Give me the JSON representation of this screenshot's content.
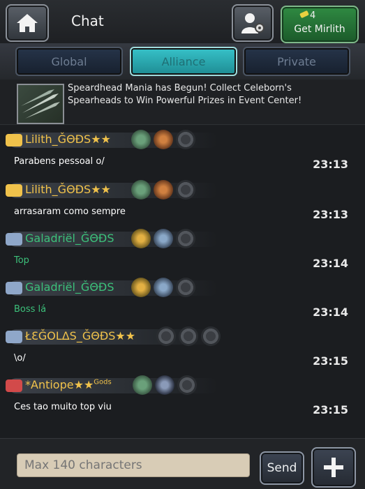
{
  "header": {
    "title": "Chat",
    "mirlith_count": "4",
    "mirlith_label": "Get Mirlith"
  },
  "tabs": [
    {
      "label": "Global",
      "active": false
    },
    {
      "label": "Alliance",
      "active": true
    },
    {
      "label": "Private",
      "active": false
    }
  ],
  "news": {
    "text": "Speardhead Mania has Begun! Collect Celeborn's Spearheads to Win Powerful Prizes in Event Center!"
  },
  "messages": [
    {
      "name": "Lilith_ǦΘÐS★★",
      "name_color": "#f0c24b",
      "text": "Parabens pessoal o/",
      "text_color": "#ffffff",
      "time": "23:13",
      "icon": "crown-icon",
      "badges": [
        "gem-badge",
        "red-crest-badge",
        "empty-badge"
      ]
    },
    {
      "name": "Lilith_ǦΘÐS★★",
      "name_color": "#f0c24b",
      "text": "arrasaram como sempre",
      "text_color": "#ffffff",
      "time": "23:13",
      "icon": "crown-icon",
      "badges": [
        "gem-badge",
        "red-crest-badge",
        "empty-badge"
      ]
    },
    {
      "name": "Galadriël_ǦΘÐS",
      "name_color": "#3cc07a",
      "text": "Top",
      "text_color": "#3cc07a",
      "time": "23:14",
      "icon": "wing-icon",
      "badges": [
        "gold-crest-badge",
        "blue-crest-badge",
        "empty-badge"
      ]
    },
    {
      "name": "Galadriël_ǦΘÐS",
      "name_color": "#3cc07a",
      "text": "Boss lá",
      "text_color": "#3cc07a",
      "time": "23:14",
      "icon": "wing-icon",
      "badges": [
        "gold-crest-badge",
        "blue-crest-badge",
        "empty-badge"
      ]
    },
    {
      "name": "ŁƐǦOLΔS_ǦΘÐS★★",
      "name_color": "#f0c24b",
      "text": "\\o/",
      "text_color": "#ffffff",
      "time": "23:15",
      "icon": "wing-icon",
      "badges": [
        "empty-badge",
        "empty-badge",
        "empty-badge"
      ]
    },
    {
      "name": "*Antiope★★",
      "name_suffix": "Gods",
      "name_color": "#f0c24b",
      "text": "Ces tao muito top viu",
      "text_color": "#ffffff",
      "time": "23:15",
      "icon": "scroll-icon",
      "badges": [
        "gem-badge",
        "dark-crest-badge",
        "empty-badge"
      ]
    }
  ],
  "input": {
    "placeholder": "Max 140 characters"
  },
  "buttons": {
    "send": "Send"
  },
  "colors": {
    "accent": "#2fb6bd",
    "gold": "#f0c24b",
    "green": "#3cc07a"
  }
}
